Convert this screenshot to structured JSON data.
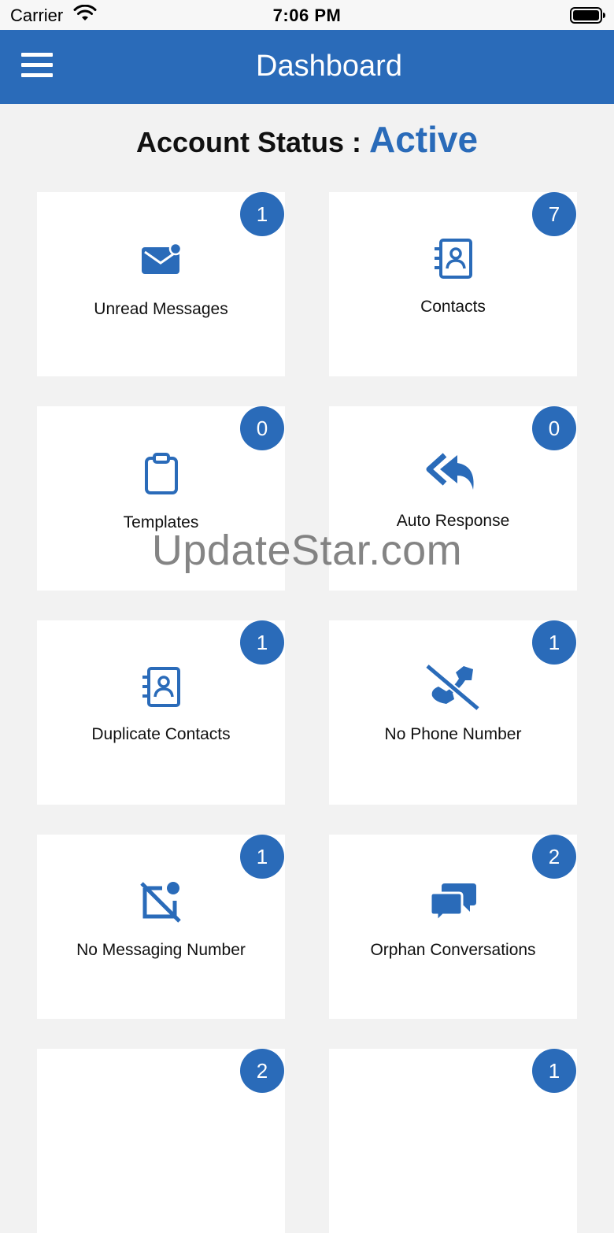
{
  "status_bar": {
    "carrier": "Carrier",
    "time": "7:06 PM"
  },
  "header": {
    "title": "Dashboard"
  },
  "account": {
    "label": "Account Status : ",
    "value": "Active"
  },
  "tiles": [
    {
      "label": "Unread Messages",
      "count": "1",
      "icon": "envelope-icon"
    },
    {
      "label": "Contacts",
      "count": "7",
      "icon": "contact-book-icon"
    },
    {
      "label": "Templates",
      "count": "0",
      "icon": "clipboard-icon"
    },
    {
      "label": "Auto Response",
      "count": "0",
      "icon": "reply-all-icon"
    },
    {
      "label": "Duplicate Contacts",
      "count": "1",
      "icon": "contact-book-icon"
    },
    {
      "label": "No Phone Number",
      "count": "1",
      "icon": "phone-slash-icon"
    },
    {
      "label": "No Messaging Number",
      "count": "1",
      "icon": "messaging-slash-icon"
    },
    {
      "label": "Orphan Conversations",
      "count": "2",
      "icon": "chat-bubbles-icon"
    },
    {
      "label": "",
      "count": "2",
      "icon": ""
    },
    {
      "label": "",
      "count": "1",
      "icon": ""
    }
  ],
  "watermark": "UpdateStar.com",
  "colors": {
    "brand": "#2a6bb9",
    "background": "#f2f2f2"
  }
}
